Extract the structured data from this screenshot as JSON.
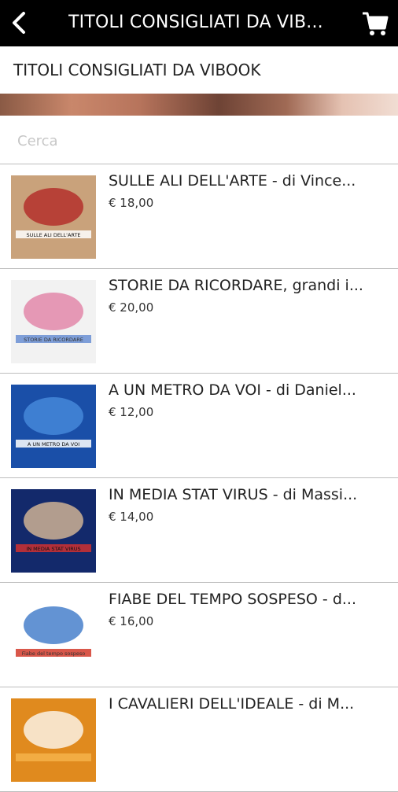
{
  "topbar": {
    "title": "TITOLI CONSIGLIATI DA VIB...",
    "back_icon": "chevron-left-icon",
    "cart_icon": "cart-icon"
  },
  "subheader": {
    "title": "TITOLI CONSIGLIATI DA VIBOOK"
  },
  "search": {
    "placeholder": "Cerca",
    "value": ""
  },
  "products": [
    {
      "title": "SULLE ALI DELL'ARTE - di Vince...",
      "price": "€ 18,00",
      "cover": {
        "text": "SULLE ALI DELL'ARTE",
        "colors": [
          "#c9a27b",
          "#ffffff",
          "#b02020"
        ]
      }
    },
    {
      "title": "STORIE DA RICORDARE, grandi i...",
      "price": "€ 20,00",
      "cover": {
        "text": "STORIE DA RICORDARE",
        "colors": [
          "#f2f2f2",
          "#6a8fd4",
          "#e07aa0"
        ]
      }
    },
    {
      "title": "A UN METRO DA VOI - di Daniel...",
      "price": "€ 12,00",
      "cover": {
        "text": "A UN METRO DA VOI",
        "colors": [
          "#1a4fa8",
          "#ffffff",
          "#4b8fe0"
        ]
      }
    },
    {
      "title": "IN MEDIA STAT VIRUS - di Massi...",
      "price": "€ 14,00",
      "cover": {
        "text": "IN MEDIA STAT VIRUS",
        "colors": [
          "#13296b",
          "#d03030",
          "#e8c49a"
        ]
      }
    },
    {
      "title": "FIABE DEL TEMPO SOSPESO - d...",
      "price": "€ 16,00",
      "cover": {
        "text": "Fiabe del tempo sospeso",
        "colors": [
          "#ffffff",
          "#d23a2a",
          "#2f6fc4"
        ]
      }
    },
    {
      "title": "I CAVALIERI DELL'IDEALE - di M...",
      "price": "",
      "cover": {
        "text": "",
        "colors": [
          "#e08a1e",
          "#f4b24a",
          "#ffffff"
        ]
      }
    }
  ]
}
